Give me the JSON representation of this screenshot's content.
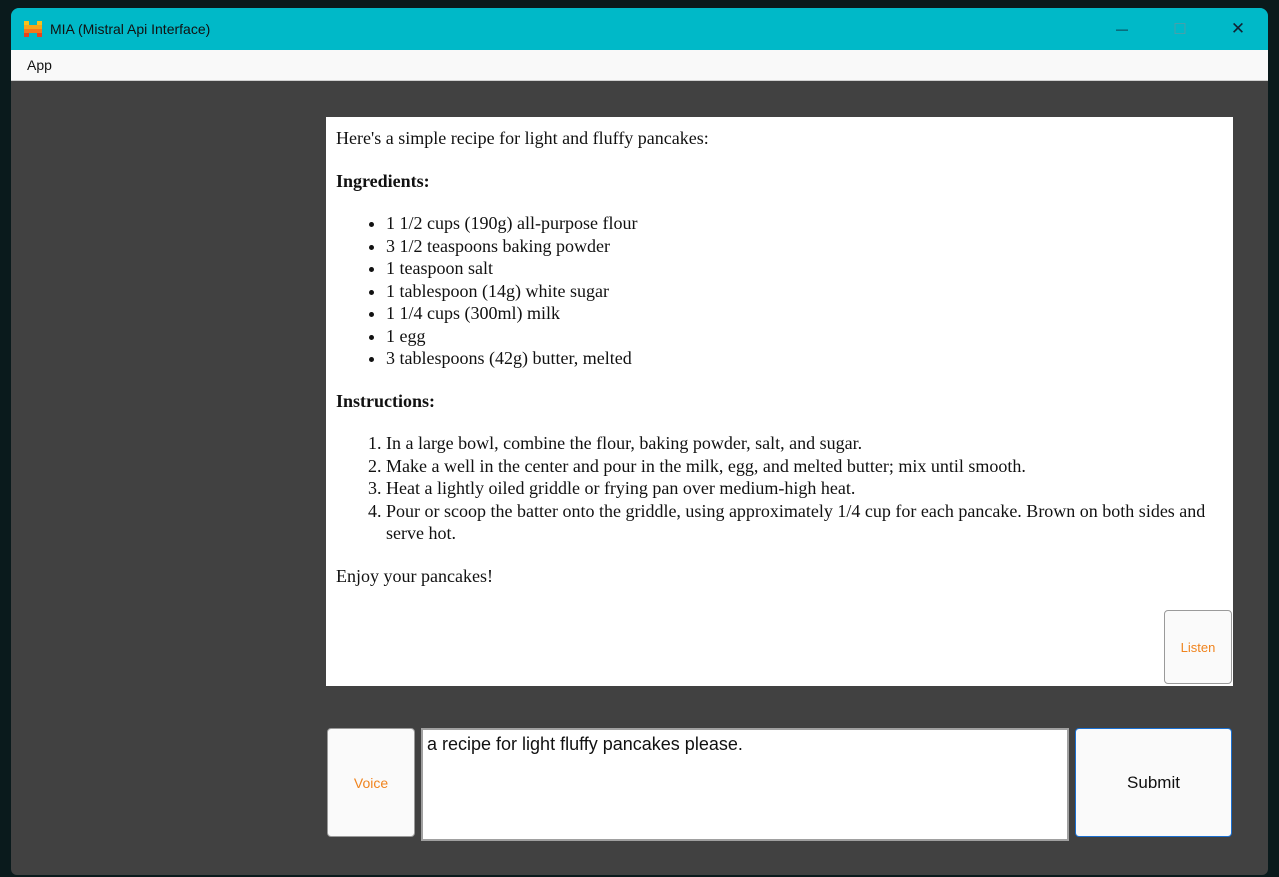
{
  "window": {
    "title": "MIA (Mistral Api Interface)",
    "controls": {
      "minimize": "—",
      "maximize": "☐",
      "close": "✕"
    }
  },
  "menu": {
    "items": [
      "App"
    ]
  },
  "response": {
    "intro": "Here's a simple recipe for light and fluffy pancakes:",
    "ingredients_heading": "Ingredients:",
    "ingredients": [
      "1 1/2 cups (190g) all-purpose flour",
      "3 1/2 teaspoons baking powder",
      "1 teaspoon salt",
      "1 tablespoon (14g) white sugar",
      "1 1/4 cups (300ml) milk",
      "1 egg",
      "3 tablespoons (42g) butter, melted"
    ],
    "instructions_heading": "Instructions:",
    "instructions": [
      "In a large bowl, combine the flour, baking powder, salt, and sugar.",
      "Make a well in the center and pour in the milk, egg, and melted butter; mix until smooth.",
      "Heat a lightly oiled griddle or frying pan over medium-high heat.",
      "Pour or scoop the batter onto the griddle, using approximately 1/4 cup for each pancake. Brown on both sides and serve hot."
    ],
    "closing": "Enjoy your pancakes!"
  },
  "buttons": {
    "listen": "Listen",
    "voice": "Voice",
    "submit": "Submit"
  },
  "prompt": {
    "value": "a recipe for light fluffy pancakes please."
  },
  "colors": {
    "titlebar": "#00b9c8",
    "background": "#414141",
    "accent_text": "#f0841e"
  }
}
